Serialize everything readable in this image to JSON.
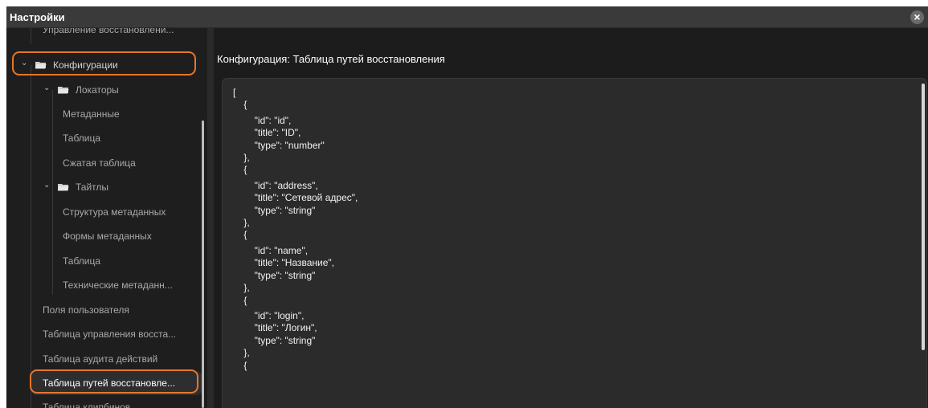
{
  "window": {
    "title": "Настройки",
    "close_icon": "close-icon"
  },
  "sidebar": {
    "items": [
      {
        "label": "Управление восстановлени...",
        "level": 1
      },
      {
        "label": "Конфигурации",
        "level": 0,
        "expanded": true,
        "icon": "folder-icon",
        "highlighted": true
      },
      {
        "label": "Локаторы",
        "level": 1,
        "expanded": true,
        "icon": "folder-icon"
      },
      {
        "label": "Метаданные",
        "level": 2
      },
      {
        "label": "Таблица",
        "level": 2
      },
      {
        "label": "Сжатая таблица",
        "level": 2
      },
      {
        "label": "Тайтлы",
        "level": 1,
        "expanded": true,
        "icon": "folder-icon"
      },
      {
        "label": "Структура метаданных",
        "level": 2
      },
      {
        "label": "Формы метаданных",
        "level": 2
      },
      {
        "label": "Таблица",
        "level": 2
      },
      {
        "label": "Технические метаданн...",
        "level": 2
      },
      {
        "label": "Поля пользователя",
        "level": 1
      },
      {
        "label": "Таблица управления восста...",
        "level": 1
      },
      {
        "label": "Таблица аудита действий",
        "level": 1
      },
      {
        "label": "Таблица путей восстановле...",
        "level": 1,
        "selected": true,
        "highlighted": true
      },
      {
        "label": "Таблица клипбинов",
        "level": 1
      }
    ]
  },
  "main": {
    "heading": "Конфигурация: Таблица путей восстановления",
    "code_lines": [
      "[",
      "    {",
      "        \"id\": \"id\",",
      "        \"title\": \"ID\",",
      "        \"type\": \"number\"",
      "    },",
      "    {",
      "        \"id\": \"address\",",
      "        \"title\": \"Сетевой адрес\",",
      "        \"type\": \"string\"",
      "    },",
      "    {",
      "        \"id\": \"name\",",
      "        \"title\": \"Название\",",
      "        \"type\": \"string\"",
      "    },",
      "    {",
      "        \"id\": \"login\",",
      "        \"title\": \"Логин\",",
      "        \"type\": \"string\"",
      "    },",
      "    {"
    ]
  },
  "colors": {
    "highlight": "#e8752a",
    "background": "#1c1c1c",
    "code_panel": "#2b2b2b"
  }
}
